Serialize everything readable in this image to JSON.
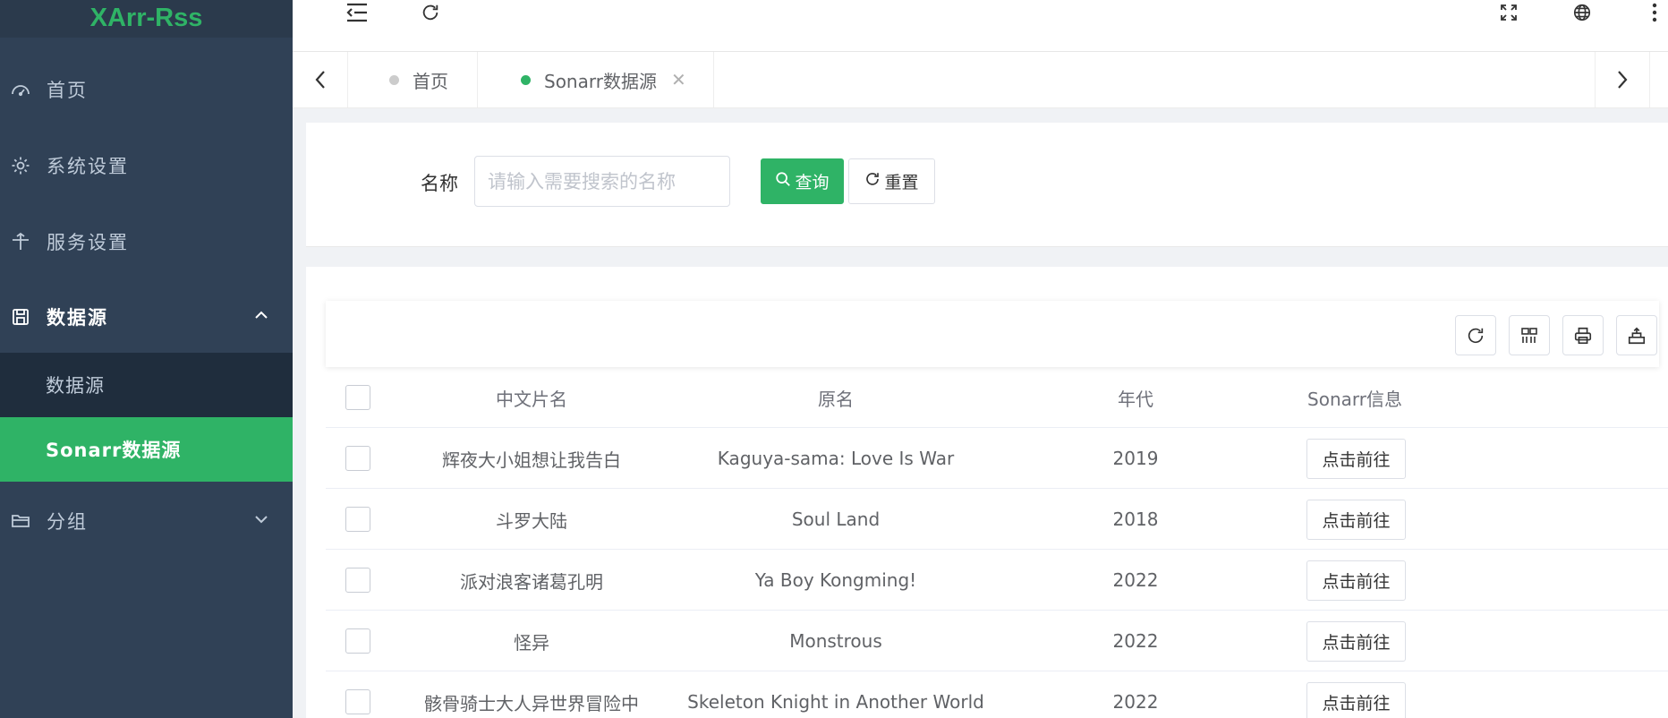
{
  "app": {
    "title": "XArr-Rss"
  },
  "colors": {
    "accent": "#2fb366",
    "sidebar_bg": "#304156",
    "submenu_bg": "#1f2d3d"
  },
  "sidebar": {
    "items": [
      {
        "label": "首页",
        "icon": "dashboard-icon"
      },
      {
        "label": "系统设置",
        "icon": "gear-icon"
      },
      {
        "label": "服务设置",
        "icon": "service-icon"
      },
      {
        "label": "数据源",
        "icon": "save-icon",
        "expanded": true
      },
      {
        "label": "分组",
        "icon": "folder-icon",
        "expanded": false
      }
    ],
    "submenu": [
      {
        "label": "数据源"
      },
      {
        "label": "Sonarr数据源",
        "active": true
      }
    ]
  },
  "navbar": {
    "icons": [
      "fold-menu-icon",
      "refresh-icon",
      "fullscreen-icon",
      "language-icon",
      "more-icon"
    ]
  },
  "tags": [
    {
      "label": "首页",
      "active": false
    },
    {
      "label": "Sonarr数据源",
      "active": true
    }
  ],
  "search": {
    "label": "名称",
    "placeholder": "请输入需要搜索的名称",
    "value": "",
    "query_label": "查询",
    "reset_label": "重置"
  },
  "toolbar": {
    "icons": [
      "refresh-icon",
      "columns-icon",
      "print-icon",
      "export-icon"
    ]
  },
  "table": {
    "columns": [
      "中文片名",
      "原名",
      "年代",
      "Sonarr信息"
    ],
    "rows": [
      {
        "cn": "辉夜大小姐想让我告白",
        "orig": "Kaguya-sama: Love Is War",
        "year": "2019",
        "action": "点击前往"
      },
      {
        "cn": "斗罗大陆",
        "orig": "Soul Land",
        "year": "2018",
        "action": "点击前往"
      },
      {
        "cn": "派对浪客诸葛孔明",
        "orig": "Ya Boy Kongming!",
        "year": "2022",
        "action": "点击前往"
      },
      {
        "cn": "怪异",
        "orig": "Monstrous",
        "year": "2022",
        "action": "点击前往"
      },
      {
        "cn": "骸骨骑士大人异世界冒险中",
        "orig": "Skeleton Knight in Another World",
        "year": "2022",
        "action": "点击前往"
      }
    ]
  }
}
